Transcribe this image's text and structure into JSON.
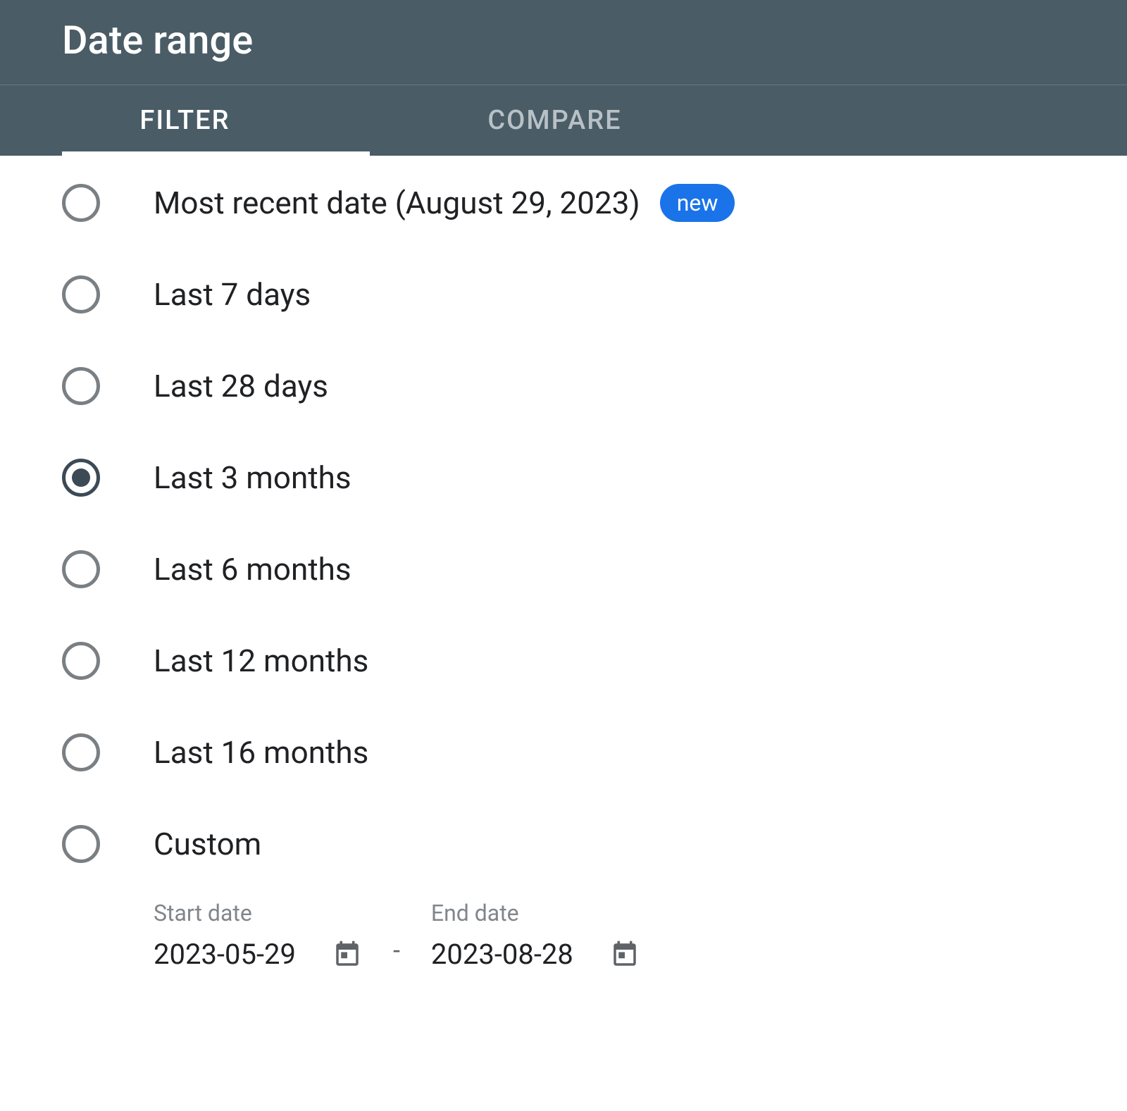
{
  "title": "Date range",
  "tabs": {
    "filter": "FILTER",
    "compare": "COMPARE",
    "active": "filter"
  },
  "options": [
    {
      "id": "most-recent",
      "label": "Most recent date (August 29, 2023)",
      "selected": false,
      "badge": "new"
    },
    {
      "id": "last-7",
      "label": "Last 7 days",
      "selected": false
    },
    {
      "id": "last-28",
      "label": "Last 28 days",
      "selected": false
    },
    {
      "id": "last-3m",
      "label": "Last 3 months",
      "selected": true
    },
    {
      "id": "last-6m",
      "label": "Last 6 months",
      "selected": false
    },
    {
      "id": "last-12m",
      "label": "Last 12 months",
      "selected": false
    },
    {
      "id": "last-16m",
      "label": "Last 16 months",
      "selected": false
    },
    {
      "id": "custom",
      "label": "Custom",
      "selected": false
    }
  ],
  "customRange": {
    "startLabel": "Start date",
    "startValue": "2023-05-29",
    "endLabel": "End date",
    "endValue": "2023-08-28"
  }
}
